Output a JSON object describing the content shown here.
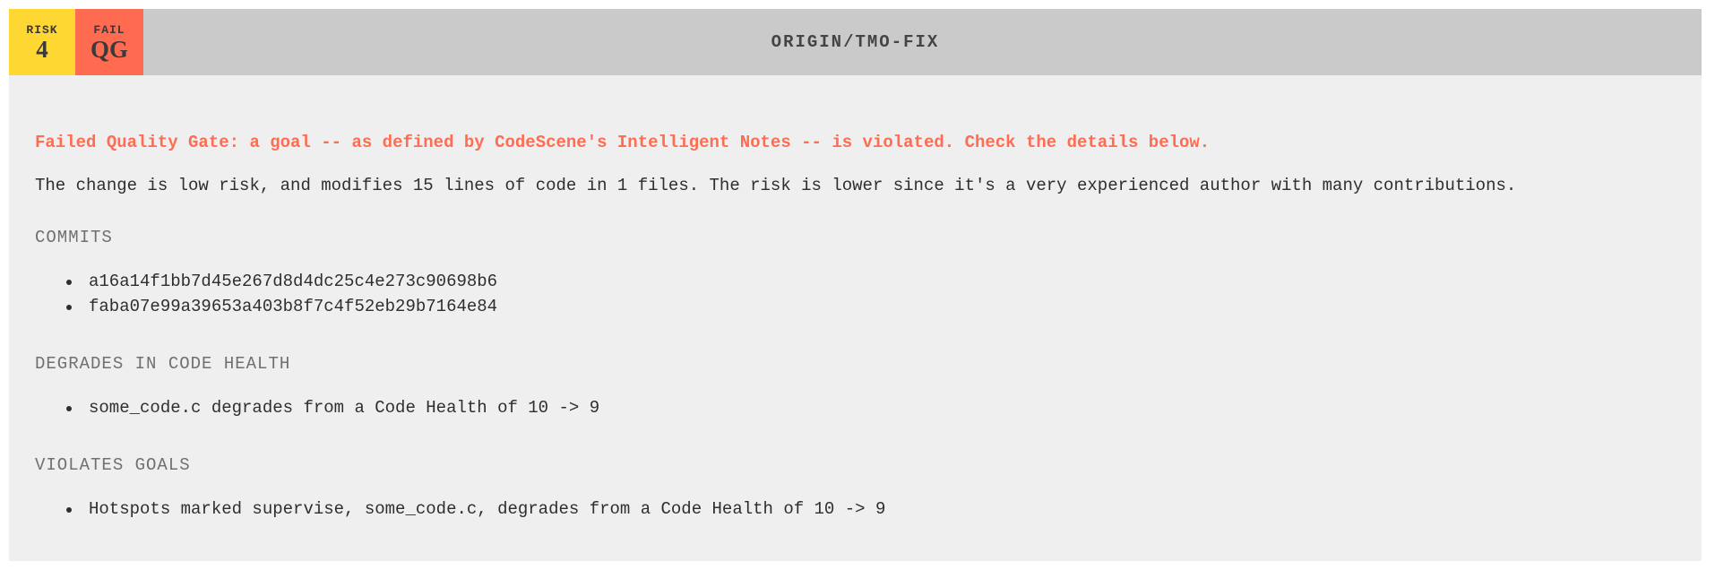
{
  "header": {
    "risk_badge": {
      "label": "RISK",
      "value": "4",
      "color": "#fed733"
    },
    "fail_badge": {
      "label": "FAIL",
      "value": "QG",
      "color": "#ff6b50"
    },
    "title": "ORIGIN/TMO-FIX"
  },
  "warning": "Failed Quality Gate: a goal -- as defined by CodeScene's Intelligent Notes -- is violated. Check the details below.",
  "summary": "The change is low risk, and modifies 15 lines of code in 1 files. The risk is lower since it's a very experienced author with many contributions.",
  "sections": {
    "commits": {
      "title": "COMMITS",
      "items": [
        "a16a14f1bb7d45e267d8d4dc25c4e273c90698b6",
        "faba07e99a39653a403b8f7c4f52eb29b7164e84"
      ]
    },
    "degrades": {
      "title": "DEGRADES IN CODE HEALTH",
      "items": [
        "some_code.c degrades from a Code Health of 10 -> 9"
      ]
    },
    "violates": {
      "title": "VIOLATES GOALS",
      "items": [
        "Hotspots marked supervise, some_code.c, degrades from a Code Health of 10 -> 9"
      ]
    }
  },
  "colors": {
    "warning": "#fe6c52",
    "header_bg": "#cacaca",
    "panel_bg": "#efefef"
  }
}
